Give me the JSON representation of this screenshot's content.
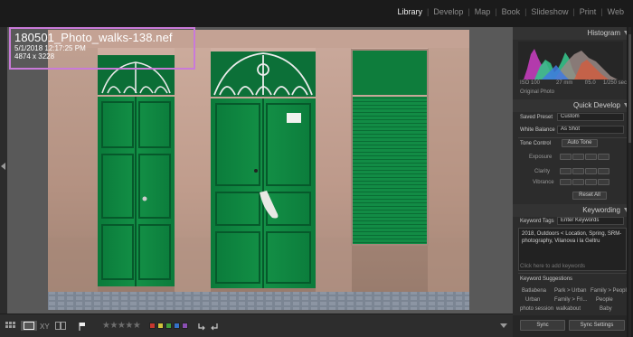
{
  "modules": [
    {
      "label": "Library",
      "active": true
    },
    {
      "label": "Develop",
      "active": false
    },
    {
      "label": "Map",
      "active": false
    },
    {
      "label": "Book",
      "active": false
    },
    {
      "label": "Slideshow",
      "active": false
    },
    {
      "label": "Print",
      "active": false
    },
    {
      "label": "Web",
      "active": false
    }
  ],
  "overlay": {
    "filename": "180501_Photo_walks-138.nef",
    "datetime": "5/1/2018 12:17:25 PM",
    "dimensions": "4874 x 3228"
  },
  "overlay_color": "#c97ad9",
  "histogram": {
    "title": "Histogram",
    "iso": "ISO 100",
    "focal": "27 mm",
    "aperture": "f/5.0",
    "shutter": "1/250 sec",
    "original": "Original Photo"
  },
  "quick_develop": {
    "title": "Quick Develop",
    "saved_preset_label": "Saved Preset",
    "saved_preset_value": "Custom",
    "white_balance_label": "White Balance",
    "white_balance_value": "As Shot",
    "tone_control_label": "Tone Control",
    "auto_tone": "Auto Tone",
    "exposure": "Exposure",
    "clarity": "Clarity",
    "vibrance": "Vibrance",
    "reset_all": "Reset All"
  },
  "keywording": {
    "title": "Keywording",
    "keyword_tags_label": "Keyword Tags",
    "keyword_tags_value": "Enter Keywords",
    "keywords_text": "2018, Outdoors < Location, Spring, SRM-photography, Vilanova i la Geltru",
    "placeholder": "Click here to add keywords",
    "suggestions_label": "Keyword Suggestions",
    "suggestions": [
      "Batlabena",
      "Park > Urban",
      "Family > People",
      "Urban",
      "Family > Fri...",
      "People",
      "photo session",
      "walkabout",
      "Baby"
    ]
  },
  "buttons": {
    "sync": "Sync",
    "sync_settings": "Sync Settings"
  },
  "color_labels": [
    "#c7372f",
    "#d1c23b",
    "#3f9e3b",
    "#3571c8",
    "#8a4fb2"
  ],
  "icons": [
    "grid-view-icon",
    "loupe-view-icon",
    "compare-view-icon",
    "survey-view-icon",
    "flag-icon",
    "rotate-left-icon",
    "rotate-right-icon"
  ]
}
